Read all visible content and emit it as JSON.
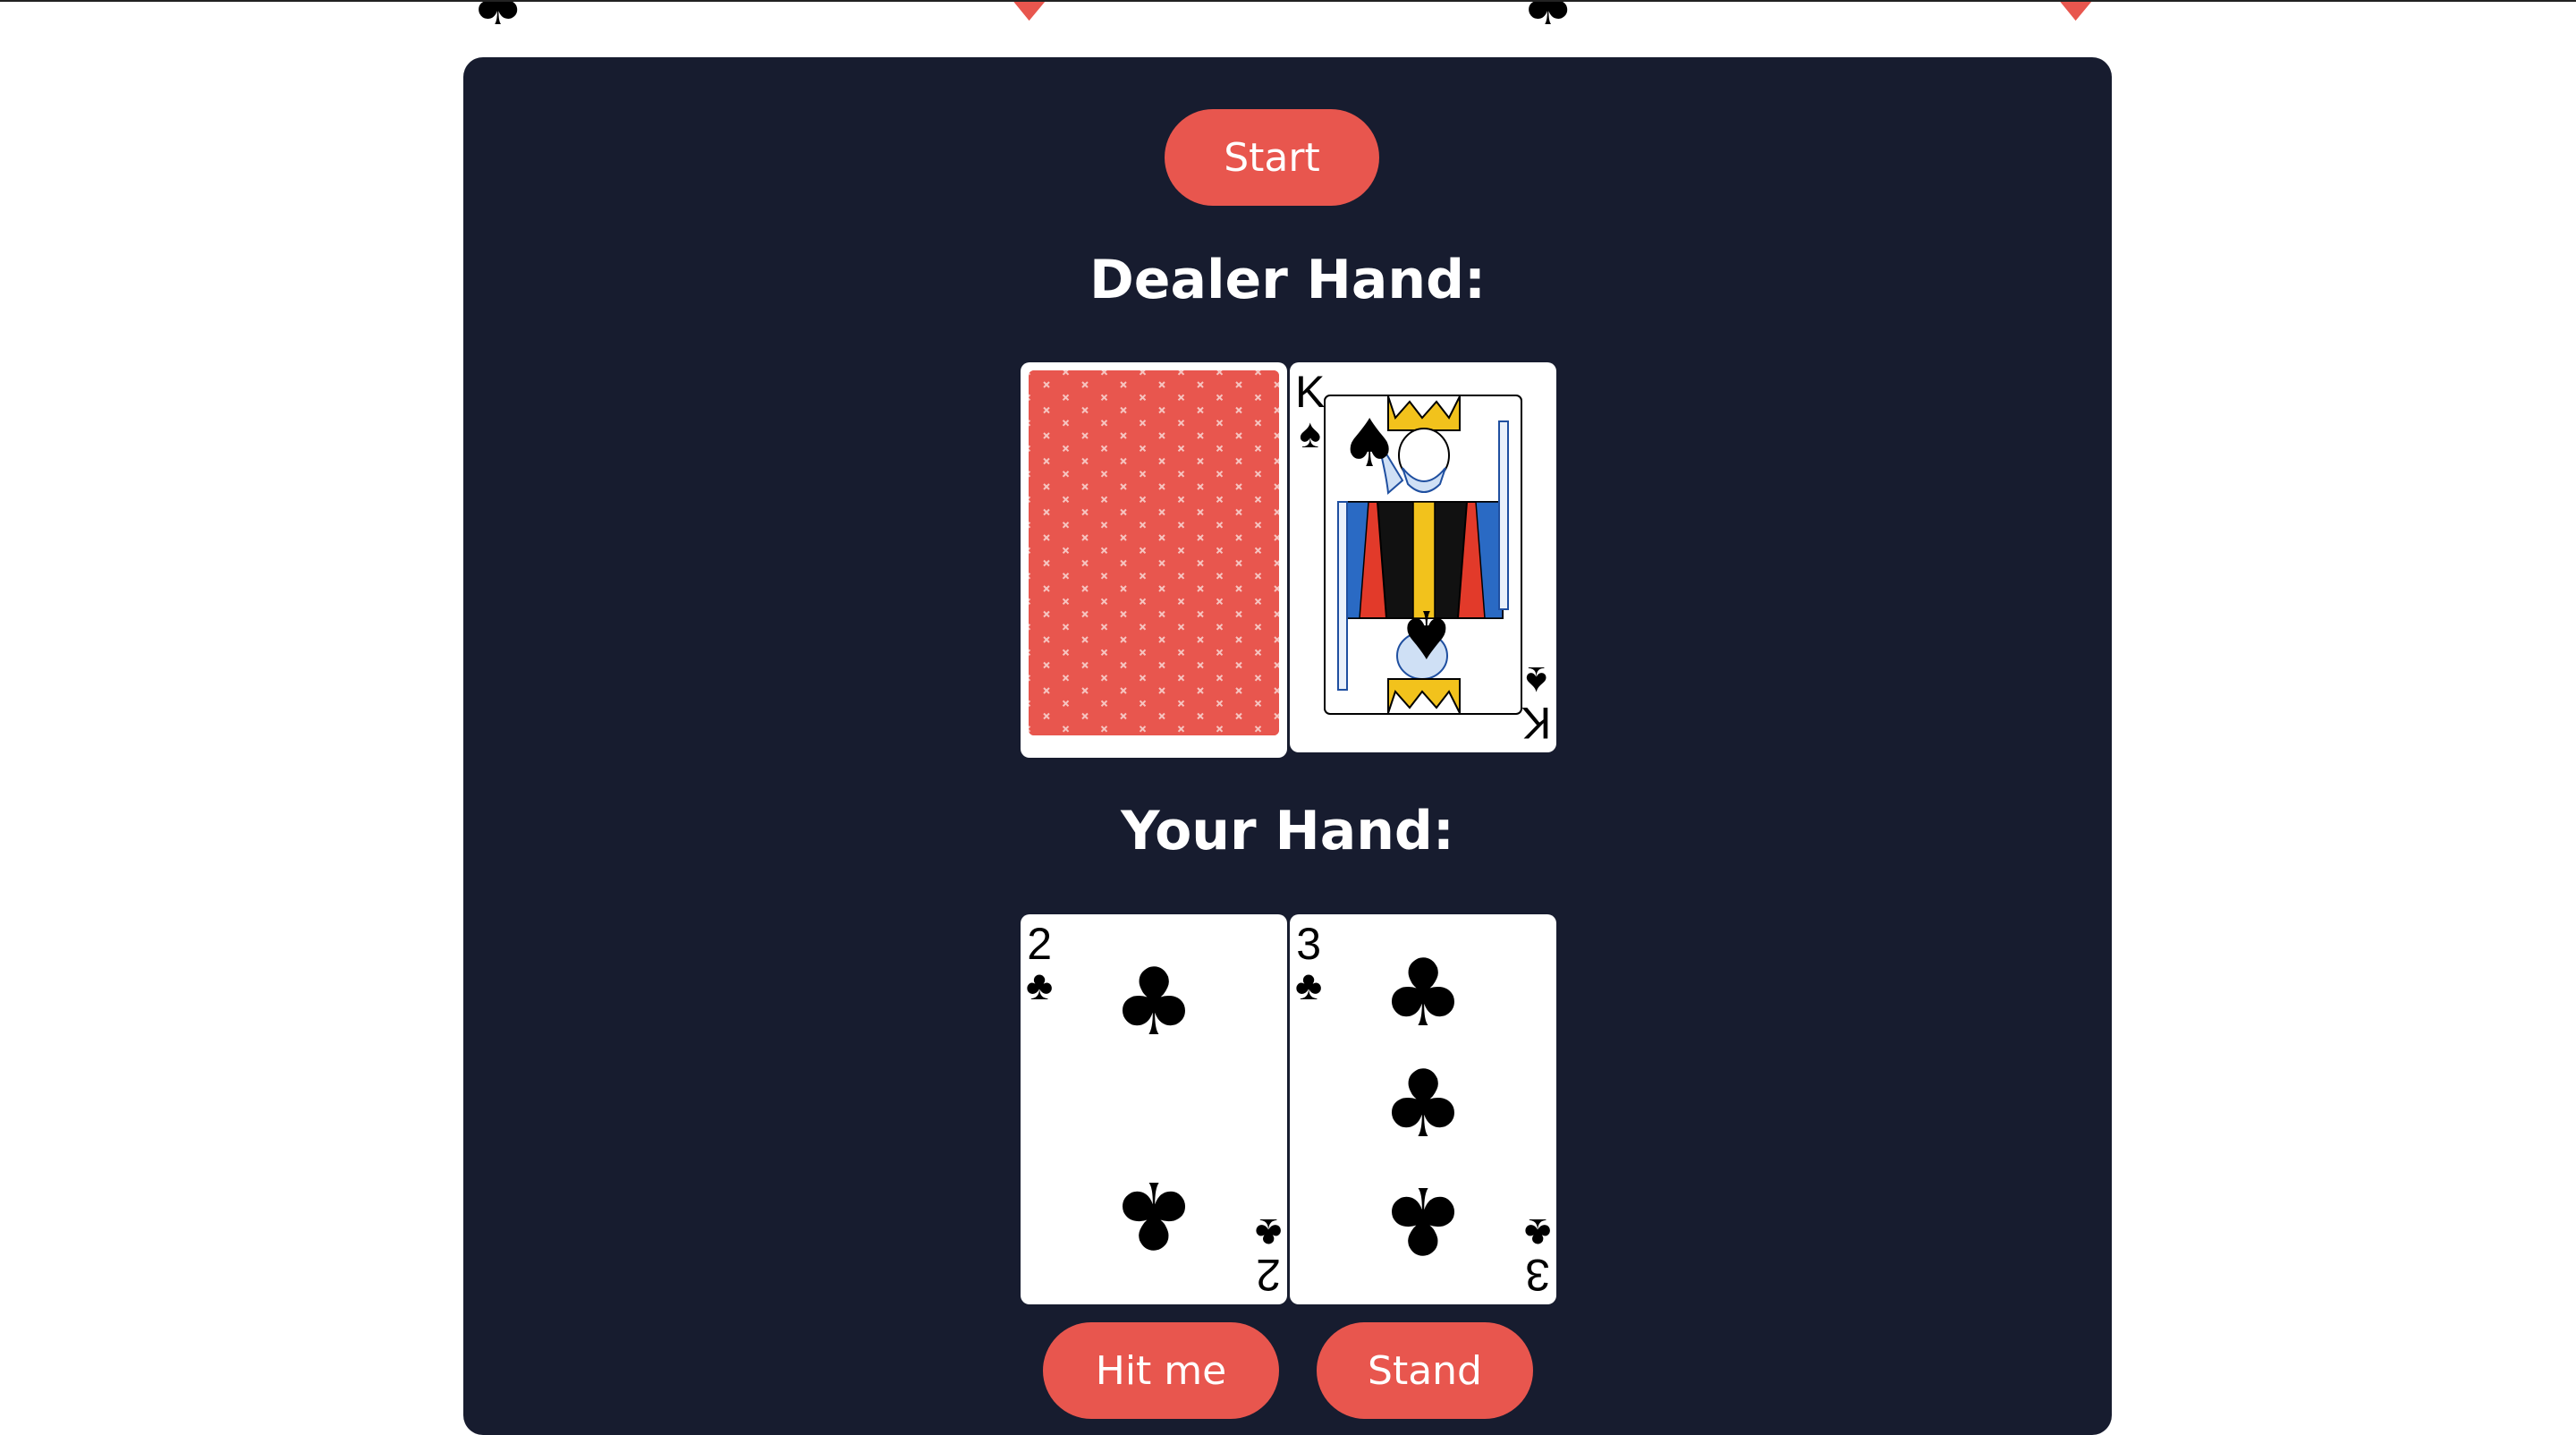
{
  "top_strip": {
    "suits": [
      {
        "icon": "club-icon",
        "glyph": "♣",
        "color": "#000000"
      },
      {
        "icon": "heart-icon",
        "glyph": "♥",
        "color": "#e8564e"
      },
      {
        "icon": "club-icon",
        "glyph": "♣",
        "color": "#000000"
      },
      {
        "icon": "heart-icon",
        "glyph": "♥",
        "color": "#e8564e"
      }
    ]
  },
  "controls": {
    "start_label": "Start",
    "hit_label": "Hit me",
    "stand_label": "Stand"
  },
  "dealer": {
    "title": "Dealer Hand:",
    "cards": [
      {
        "face_down": true
      },
      {
        "rank": "K",
        "suit": "♠",
        "suit_name": "spades"
      }
    ]
  },
  "player": {
    "title": "Your Hand:",
    "cards": [
      {
        "rank": "2",
        "suit": "♣",
        "suit_name": "clubs"
      },
      {
        "rank": "3",
        "suit": "♣",
        "suit_name": "clubs"
      }
    ]
  },
  "colors": {
    "accent": "#e8564e",
    "panel": "#171c2f",
    "text": "#ffffff"
  }
}
